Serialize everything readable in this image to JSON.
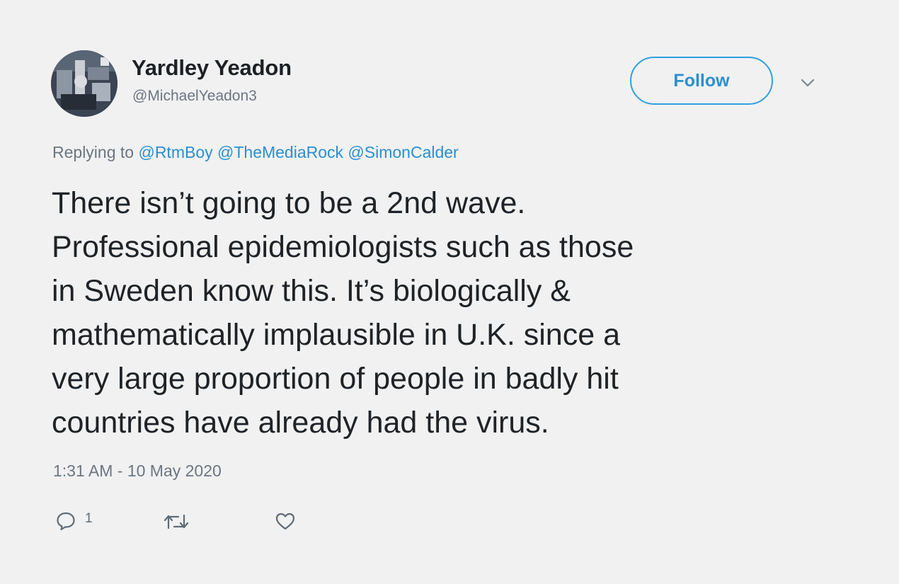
{
  "user": {
    "name": "Yardley Yeadon",
    "handle": "@MichaelYeadon3"
  },
  "follow_label": "Follow",
  "reply_line": {
    "prefix": "Replying to",
    "mentions": [
      "@RtmBoy",
      "@TheMediaRock",
      "@SimonCalder"
    ]
  },
  "tweet_lines": [
    "There isn’t going to be a 2nd wave.",
    "Professional epidemiologists such as those",
    "in Sweden know this. It’s biologically &",
    "mathematically implausible in U.K. since a",
    "very large proportion of people in badly hit",
    "countries have already had the virus."
  ],
  "timestamp": "1:31 AM - 10 May 2020",
  "actions": {
    "reply_count": "1",
    "reply_icon": "reply-bubble-icon",
    "retweet_icon": "retweet-icon",
    "like_icon": "heart-icon"
  },
  "colors": {
    "background": "#f1f1f1",
    "accent": "#2b8fd0",
    "muted": "#6b7682"
  }
}
